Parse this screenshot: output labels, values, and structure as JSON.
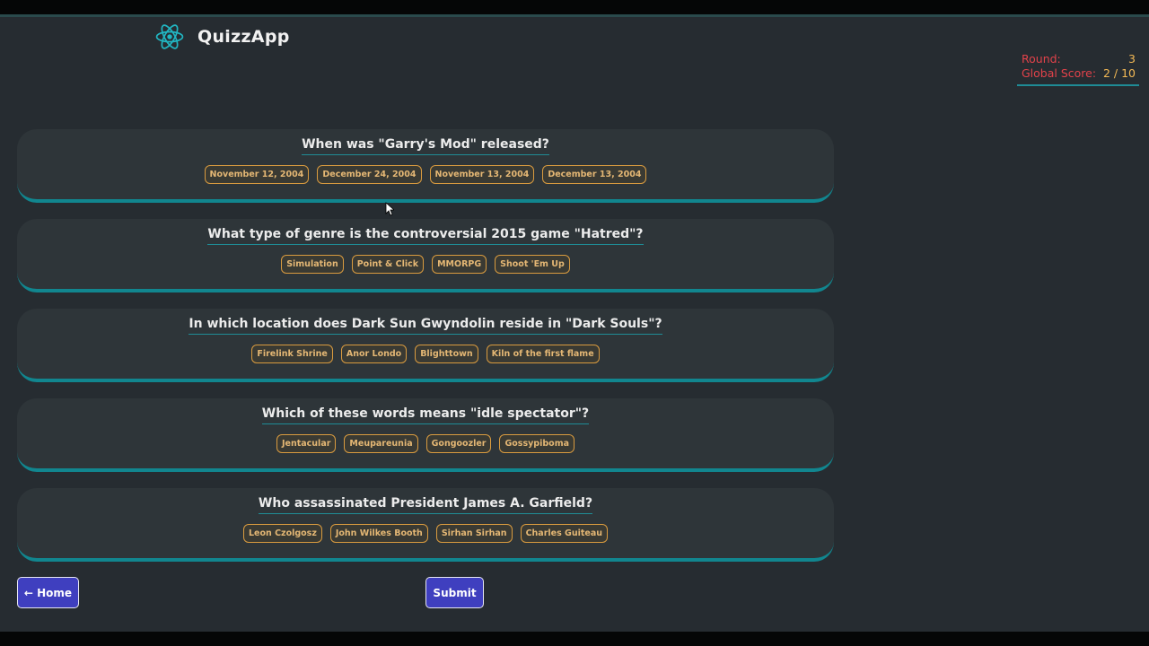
{
  "app": {
    "name": "QuizzApp",
    "logo_icon": "react-atom-icon",
    "accent": "#1f8c96"
  },
  "score": {
    "round_label": "Round:",
    "round_value": "3",
    "global_label": "Global Score:",
    "global_value": "2 / 10"
  },
  "questions": [
    {
      "text": "When was \"Garry's Mod\" released?",
      "answers": [
        "November 12, 2004",
        "December 24, 2004",
        "November 13, 2004",
        "December 13, 2004"
      ]
    },
    {
      "text": "What type of genre is the controversial 2015 game \"Hatred\"?",
      "answers": [
        "Simulation",
        "Point & Click",
        "MMORPG",
        "Shoot 'Em Up"
      ]
    },
    {
      "text": "In which location does Dark Sun Gwyndolin reside in \"Dark Souls\"?",
      "answers": [
        "Firelink Shrine",
        "Anor Londo",
        "Blighttown",
        "Kiln of the first flame"
      ]
    },
    {
      "text": "Which of these words means \"idle spectator\"?",
      "answers": [
        "Jentacular",
        "Meupareunia",
        "Gongoozler",
        "Gossypiboma"
      ]
    },
    {
      "text": "Who assassinated President James A. Garfield?",
      "answers": [
        "Leon Czolgosz",
        "John Wilkes Booth",
        "Sirhan Sirhan",
        "Charles Guiteau"
      ]
    }
  ],
  "nav": {
    "home_label": "← Home",
    "submit_label": "Submit"
  }
}
